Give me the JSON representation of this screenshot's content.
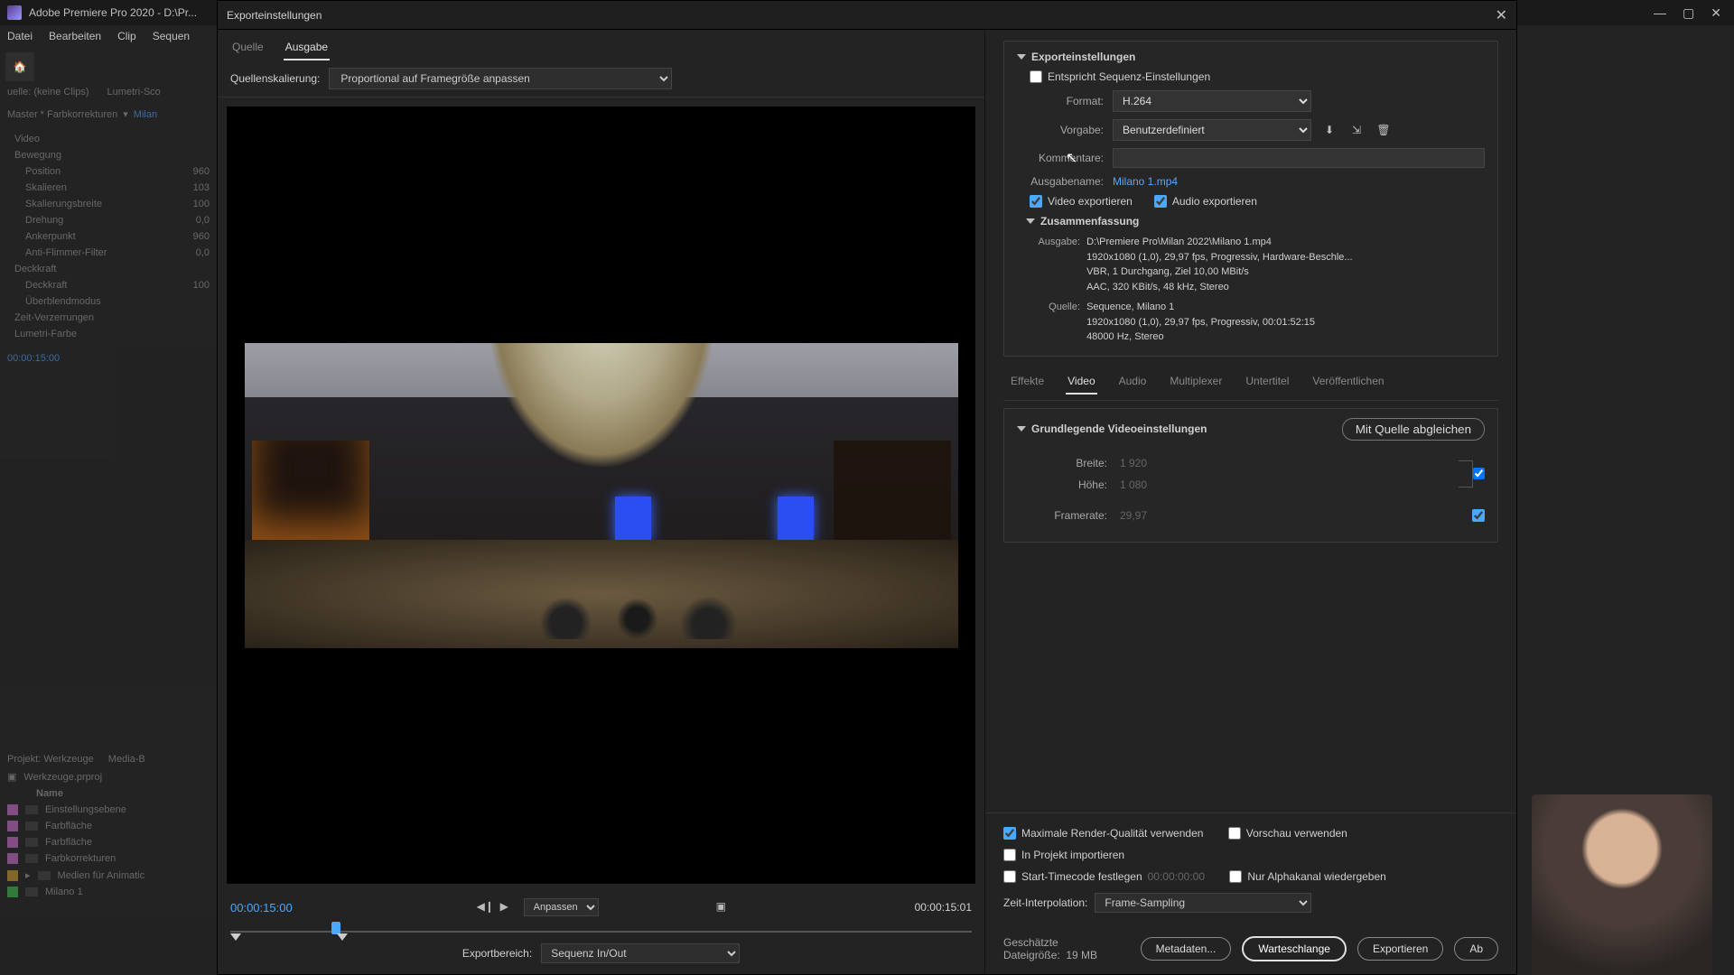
{
  "titlebar": {
    "app": "Adobe Premiere Pro 2020 - D:\\Pr..."
  },
  "menubar": [
    "Datei",
    "Bearbeiten",
    "Clip",
    "Sequen"
  ],
  "left_panel": {
    "source_label": "uelle: (keine Clips)",
    "lumetri_label": "Lumetri-Sco",
    "master_label": "Master * Farbkorrekturen",
    "master_link": "Milan",
    "video_label": "Video",
    "effects": {
      "bewegung": "Bewegung",
      "position": "Position",
      "position_v": "960",
      "skalieren": "Skalieren",
      "skalieren_v": "103",
      "skbreite": "Skalierungsbreite",
      "skbreite_v": "100",
      "drehung": "Drehung",
      "drehung_v": "0,0",
      "anker": "Ankerpunkt",
      "anker_v": "960",
      "flimmer": "Anti-Flimmer-Filter",
      "flimmer_v": "0,0",
      "deck_h": "Deckkraft",
      "deck": "Deckkraft",
      "deck_v": "100",
      "blend": "Überblendmodus",
      "zeit": "Zeit-Verzerrungen",
      "lumetri": "Lumetri-Farbe"
    },
    "timecode": "00:00:15:00",
    "project_tab": "Projekt: Werkzeuge",
    "media_tab": "Media-B",
    "project_file": "Werkzeuge.prproj",
    "col_name": "Name",
    "bins": [
      "Einstellungsebene",
      "Farbfläche",
      "Farbfläche",
      "Farbkorrekturen",
      "Medien für Animatic",
      "Milano 1"
    ]
  },
  "dialog": {
    "title": "Exporteinstellungen",
    "tabs_preview": {
      "source": "Quelle",
      "output": "Ausgabe"
    },
    "scaling_label": "Quellenskalierung:",
    "scaling_value": "Proportional auf Framegröße anpassen",
    "time_current": "00:00:15:00",
    "time_total": "00:00:15:01",
    "fit_label": "Anpassen",
    "range_label": "Exportbereich:",
    "range_value": "Sequenz In/Out",
    "export_settings": {
      "header": "Exporteinstellungen",
      "match_seq": "Entspricht Sequenz-Einstellungen",
      "format_label": "Format:",
      "format_value": "H.264",
      "preset_label": "Vorgabe:",
      "preset_value": "Benutzerdefiniert",
      "comments_label": "Kommentare:",
      "outname_label": "Ausgabename:",
      "outname_value": "Milano 1.mp4",
      "export_video": "Video exportieren",
      "export_audio": "Audio exportieren",
      "summary_header": "Zusammenfassung",
      "out_label": "Ausgabe:",
      "out_text": "D:\\Premiere Pro\\Milan 2022\\Milano 1.mp4\n1920x1080 (1,0), 29,97 fps, Progressiv, Hardware-Beschle...\nVBR, 1 Durchgang, Ziel 10,00 MBit/s\nAAC, 320 KBit/s, 48 kHz, Stereo",
      "src_label": "Quelle:",
      "src_text": "Sequence, Milano 1\n1920x1080 (1,0), 29,97 fps, Progressiv, 00:01:52:15\n48000 Hz, Stereo"
    },
    "tabs": {
      "effects": "Effekte",
      "video": "Video",
      "audio": "Audio",
      "mux": "Multiplexer",
      "caption": "Untertitel",
      "publish": "Veröffentlichen"
    },
    "video": {
      "basic_header": "Grundlegende Videoeinstellungen",
      "match_source": "Mit Quelle abgleichen",
      "width_label": "Breite:",
      "width_value": "1 920",
      "height_label": "Höhe:",
      "height_value": "1 080",
      "framerate_label": "Framerate:",
      "framerate_value": "29,97"
    },
    "footer": {
      "max_quality": "Maximale Render-Qualität verwenden",
      "use_preview": "Vorschau verwenden",
      "import_proj": "In Projekt importieren",
      "start_tc": "Start-Timecode festlegen",
      "tc_value": "00:00:00:00",
      "alpha_only": "Nur Alphakanal wiedergeben",
      "interp_label": "Zeit-Interpolation:",
      "interp_value": "Frame-Sampling",
      "est_label": "Geschätzte Dateigröße:",
      "est_value": "19 MB",
      "btn_meta": "Metadaten...",
      "btn_queue": "Warteschlange",
      "btn_export": "Exportieren",
      "btn_cancel": "Ab"
    }
  }
}
